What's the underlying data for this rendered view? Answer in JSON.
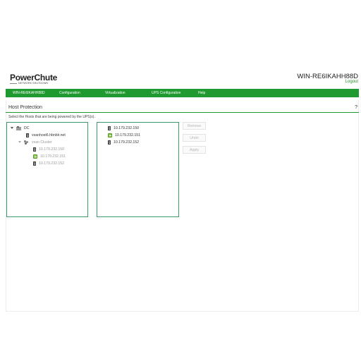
{
  "header": {
    "logo_main": "PowerChute",
    "logo_sub": "NETWORK SHUTDOWN",
    "hostname": "WIN-RE6IKAHH88D",
    "logout": "Logout"
  },
  "nav": {
    "items": [
      "WIN-RE6IKAHH88D",
      "Configuration",
      "Virtualization",
      "UPS Configuration",
      "Help"
    ]
  },
  "section": {
    "title": "Host Protection",
    "help": "?",
    "instruction": "Select the Hosts that are being powered by the UPS(s)."
  },
  "tree": {
    "datacenter": "DC",
    "host_standalone": "vsanhost6.hbnblr.net",
    "cluster": "vsan Cluster",
    "cluster_hosts": [
      "10.179.232.150",
      "10.179.232.151",
      "10.179.232.152"
    ]
  },
  "selected_hosts": [
    "10.179.232.150",
    "10.179.232.151",
    "10.179.232.152"
  ],
  "buttons": {
    "remove": "Remove",
    "undo": "Undo",
    "apply": "Apply"
  },
  "colors": {
    "brand_green": "#1e9a30",
    "panel_border": "#3a9a6a"
  }
}
